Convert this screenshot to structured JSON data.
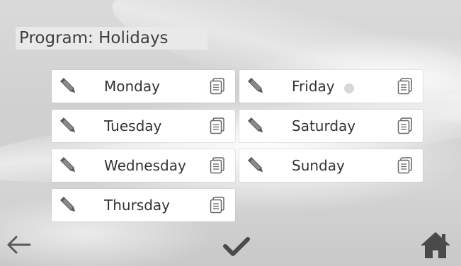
{
  "program": {
    "title": "Program: Holidays"
  },
  "days_left": [
    {
      "label": "Monday"
    },
    {
      "label": "Tuesday"
    },
    {
      "label": "Wednesday"
    },
    {
      "label": "Thursday"
    }
  ],
  "days_right": [
    {
      "label": "Friday"
    },
    {
      "label": "Saturday"
    },
    {
      "label": "Sunday"
    }
  ],
  "icons": {
    "edit": "pencil-icon",
    "copy": "copy-icon",
    "back": "back-arrow-icon",
    "confirm": "checkmark-icon",
    "home": "home-icon"
  },
  "colors": {
    "tile_bg": "#ffffff",
    "title_bg": "#e9e9e9",
    "text": "#333333",
    "icon": "#555555"
  }
}
